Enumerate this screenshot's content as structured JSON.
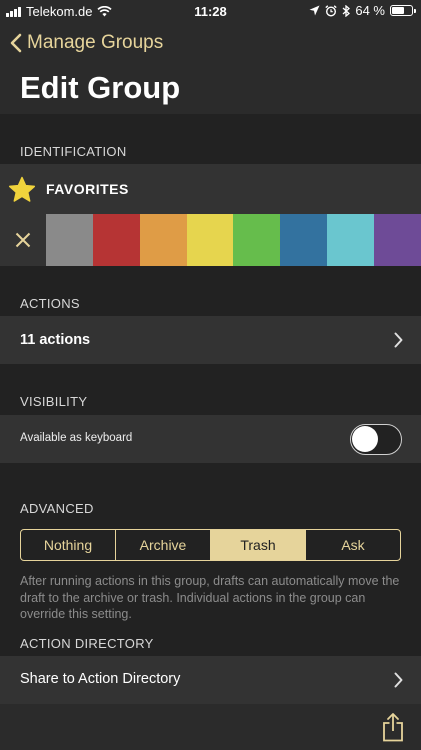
{
  "status_bar": {
    "carrier": "Telekom.de",
    "time": "11:28",
    "battery": "64 %",
    "battery_level": 0.64,
    "icons": [
      "signal-icon",
      "wifi-icon",
      "location-icon",
      "alarm-icon",
      "bluetooth-icon",
      "battery-icon"
    ]
  },
  "nav": {
    "back_label": "Manage Groups",
    "title": "Edit Group"
  },
  "identification": {
    "header": "IDENTIFICATION",
    "group_name": "FAVORITES",
    "icon": "star-icon",
    "colors": [
      "#8a8a8a",
      "#b63434",
      "#df9c46",
      "#e6d54e",
      "#66bd4c",
      "#33729f",
      "#6ac6cf",
      "#6e4b97"
    ]
  },
  "actions": {
    "header": "ACTIONS",
    "label": "11 actions"
  },
  "visibility": {
    "header": "VISIBILITY",
    "keyboard_label": "Available as keyboard",
    "keyboard_enabled": false
  },
  "advanced": {
    "header": "ADVANCED",
    "options": [
      "Nothing",
      "Archive",
      "Trash",
      "Ask"
    ],
    "selected": "Trash",
    "description": "After running actions in this group, drafts can automatically move the draft to the archive or trash. Individual actions in the group can override this setting."
  },
  "action_directory": {
    "header": "ACTION DIRECTORY",
    "share_label": "Share to Action Directory"
  },
  "theme": {
    "accent": "#e6d49b",
    "star": "#f0d33c"
  }
}
